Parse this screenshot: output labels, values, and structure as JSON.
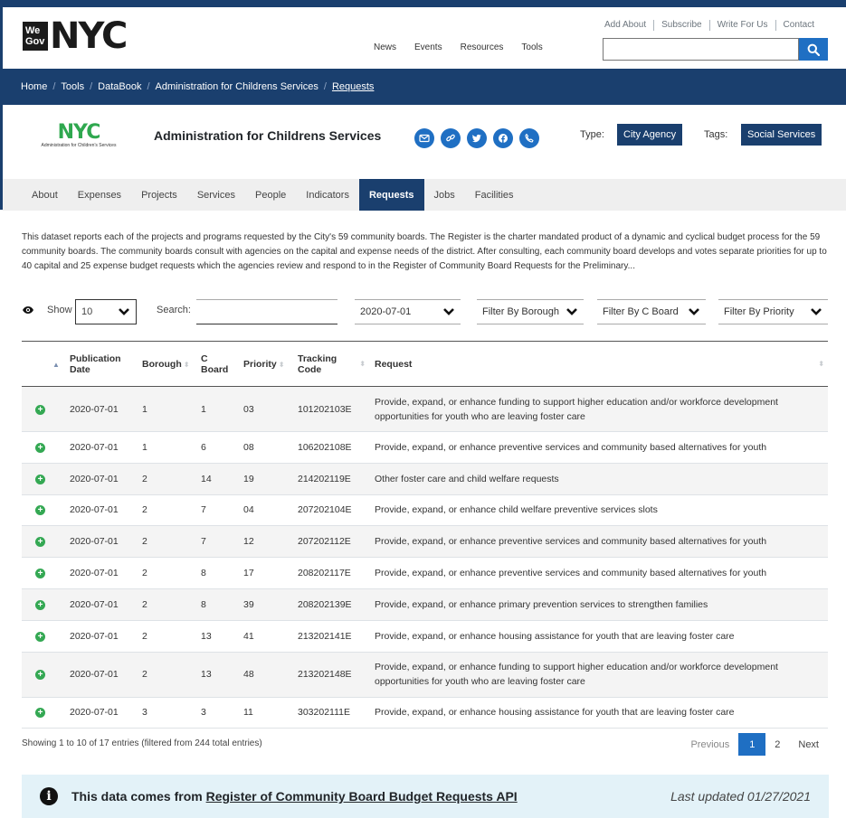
{
  "site": {
    "logo_top": "We",
    "logo_bottom": "Gov",
    "logo_main": "NYC",
    "util_links": [
      "Add About",
      "Subscribe",
      "Write For Us",
      "Contact"
    ],
    "nav": [
      "News",
      "Events",
      "Resources",
      "Tools"
    ],
    "search_value": "",
    "search_icon": "search-icon",
    "brand_color": "#1a3f6e",
    "accent_color": "#1f6fc3"
  },
  "breadcrumb": [
    "Home",
    "Tools",
    "DataBook",
    "Administration for Childrens Services",
    "Requests"
  ],
  "agency": {
    "logo_text": "NYC",
    "logo_sub": "Administration for Children's Services",
    "name": "Administration for Childrens Services",
    "type_label": "Type:",
    "type_value": "City Agency",
    "tags_label": "Tags:",
    "tags_value": "Social Services",
    "social_icons": [
      "email-icon",
      "link-icon",
      "twitter-icon",
      "facebook-icon",
      "phone-icon"
    ]
  },
  "tabs": [
    "About",
    "Expenses",
    "Projects",
    "Services",
    "People",
    "Indicators",
    "Requests",
    "Jobs",
    "Facilities"
  ],
  "active_tab": "Requests",
  "description": "This dataset reports each of the projects and programs requested by the City's 59 community boards. The Register is the charter mandated product of a dynamic and cyclical budget process for the 59 community boards. The community boards consult with agencies on the capital and expense needs of the district. After consulting, each community board develops and votes separate priorities for up to 40 capital and 25 expense budget requests which the agencies review and respond to in the Register of Community Board Requests for the Preliminary...",
  "controls": {
    "show_label": "Show",
    "show_value": "10",
    "search_label": "Search:",
    "search_value": "",
    "date_filter": "2020-07-01",
    "borough_filter": "Filter By Borough",
    "cboard_filter": "Filter By C Board",
    "priority_filter": "Filter By Priority"
  },
  "table": {
    "headers": {
      "pub_date_1": "Publication",
      "pub_date_2": "Date",
      "borough": "Borough",
      "cboard_1": "C",
      "cboard_2": "Board",
      "priority": "Priority",
      "tracking_1": "Tracking",
      "tracking_2": "Code",
      "request": "Request"
    },
    "rows": [
      {
        "date": "2020-07-01",
        "borough": "1",
        "cboard": "1",
        "priority": "03",
        "code": "101202103E",
        "request": "Provide, expand, or enhance funding to support higher education and/or workforce development opportunities for youth who are leaving foster care"
      },
      {
        "date": "2020-07-01",
        "borough": "1",
        "cboard": "6",
        "priority": "08",
        "code": "106202108E",
        "request": "Provide, expand, or enhance preventive services and community based alternatives for youth"
      },
      {
        "date": "2020-07-01",
        "borough": "2",
        "cboard": "14",
        "priority": "19",
        "code": "214202119E",
        "request": "Other foster care and child welfare requests"
      },
      {
        "date": "2020-07-01",
        "borough": "2",
        "cboard": "7",
        "priority": "04",
        "code": "207202104E",
        "request": "Provide, expand, or enhance child welfare preventive services slots"
      },
      {
        "date": "2020-07-01",
        "borough": "2",
        "cboard": "7",
        "priority": "12",
        "code": "207202112E",
        "request": "Provide, expand, or enhance preventive services and community based alternatives for youth"
      },
      {
        "date": "2020-07-01",
        "borough": "2",
        "cboard": "8",
        "priority": "17",
        "code": "208202117E",
        "request": "Provide, expand, or enhance preventive services and community based alternatives for youth"
      },
      {
        "date": "2020-07-01",
        "borough": "2",
        "cboard": "8",
        "priority": "39",
        "code": "208202139E",
        "request": "Provide, expand, or enhance primary prevention services to strengthen families"
      },
      {
        "date": "2020-07-01",
        "borough": "2",
        "cboard": "13",
        "priority": "41",
        "code": "213202141E",
        "request": "Provide, expand, or enhance housing assistance for youth that are leaving foster care"
      },
      {
        "date": "2020-07-01",
        "borough": "2",
        "cboard": "13",
        "priority": "48",
        "code": "213202148E",
        "request": "Provide, expand, or enhance funding to support higher education and/or workforce development opportunities for youth who are leaving foster care"
      },
      {
        "date": "2020-07-01",
        "borough": "3",
        "cboard": "3",
        "priority": "11",
        "code": "303202111E",
        "request": "Provide, expand, or enhance housing assistance for youth that are leaving foster care"
      }
    ]
  },
  "pagination": {
    "info": "Showing 1 to 10 of 17 entries (filtered from 244 total entries)",
    "previous": "Previous",
    "pages": [
      "1",
      "2"
    ],
    "current": "1",
    "next": "Next"
  },
  "api_banner": {
    "prefix": "This data comes from ",
    "link": "Register of Community Board Budget Requests API",
    "updated": "Last updated 01/27/2021"
  }
}
